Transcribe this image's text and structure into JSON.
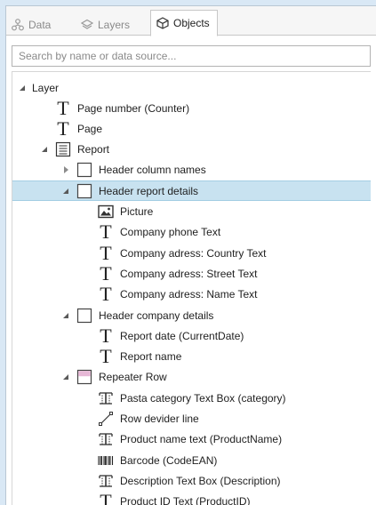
{
  "tabs": [
    {
      "label": "Data",
      "icon": "data-icon",
      "active": false
    },
    {
      "label": "Layers",
      "icon": "layers-icon",
      "active": false
    },
    {
      "label": "Objects",
      "icon": "objects-icon",
      "active": true
    }
  ],
  "search": {
    "value": "",
    "placeholder": "Search by name or data source..."
  },
  "tree": {
    "root_label": "Layer",
    "items": [
      {
        "label": "Page number (Counter)",
        "icon": "text-icon",
        "expander": "none",
        "selected": false
      },
      {
        "label": "Page",
        "icon": "text-icon",
        "expander": "none",
        "selected": false
      },
      {
        "label": "Report",
        "icon": "report-icon",
        "expander": "expanded",
        "selected": false
      },
      {
        "label": "Header column names",
        "icon": "band-icon",
        "expander": "collapsed",
        "selected": false
      },
      {
        "label": "Header report details",
        "icon": "band-icon",
        "expander": "expanded",
        "selected": true
      },
      {
        "label": "Picture",
        "icon": "picture-icon",
        "expander": "none",
        "selected": false
      },
      {
        "label": "Company phone Text",
        "icon": "text-icon",
        "expander": "none",
        "selected": false
      },
      {
        "label": "Company adress: Country Text",
        "icon": "text-icon",
        "expander": "none",
        "selected": false
      },
      {
        "label": "Company adress: Street Text",
        "icon": "text-icon",
        "expander": "none",
        "selected": false
      },
      {
        "label": "Company adress: Name Text",
        "icon": "text-icon",
        "expander": "none",
        "selected": false
      },
      {
        "label": "Header company details",
        "icon": "band-icon",
        "expander": "expanded",
        "selected": false
      },
      {
        "label": "Report date (CurrentDate)",
        "icon": "text-icon",
        "expander": "none",
        "selected": false
      },
      {
        "label": "Report name",
        "icon": "text-icon",
        "expander": "none",
        "selected": false
      },
      {
        "label": "Repeater Row",
        "icon": "repeater-icon",
        "expander": "expanded",
        "selected": false
      },
      {
        "label": "Pasta category Text Box (category)",
        "icon": "textbox-icon",
        "expander": "none",
        "selected": false
      },
      {
        "label": "Row devider line",
        "icon": "line-icon",
        "expander": "none",
        "selected": false
      },
      {
        "label": "Product name text (ProductName)",
        "icon": "textbox-icon",
        "expander": "none",
        "selected": false
      },
      {
        "label": "Barcode (CodeEAN)",
        "icon": "barcode-icon",
        "expander": "none",
        "selected": false
      },
      {
        "label": "Description Text Box (Description)",
        "icon": "textbox-icon",
        "expander": "none",
        "selected": false
      },
      {
        "label": "Product ID Text (ProductID)",
        "icon": "text-icon",
        "expander": "none",
        "selected": false
      }
    ]
  },
  "colors": {
    "selection": "#c8e2f0",
    "selection_border": "#a3cde3",
    "repeater_band": "#e6b8d6",
    "window_bg": "#d9e8f5"
  }
}
